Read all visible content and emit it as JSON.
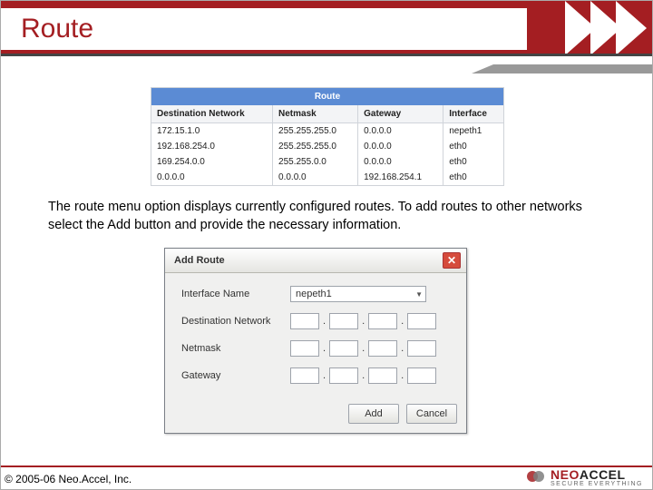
{
  "header": {
    "title": "Route"
  },
  "route_panel": {
    "title": "Route",
    "columns": [
      "Destination Network",
      "Netmask",
      "Gateway",
      "Interface"
    ],
    "rows": [
      {
        "dest": "172.15.1.0",
        "mask": "255.255.255.0",
        "gw": "0.0.0.0",
        "iface": "nepeth1"
      },
      {
        "dest": "192.168.254.0",
        "mask": "255.255.255.0",
        "gw": "0.0.0.0",
        "iface": "eth0"
      },
      {
        "dest": "169.254.0.0",
        "mask": "255.255.0.0",
        "gw": "0.0.0.0",
        "iface": "eth0"
      },
      {
        "dest": "0.0.0.0",
        "mask": "0.0.0.0",
        "gw": "192.168.254.1",
        "iface": "eth0"
      }
    ]
  },
  "description": "The route menu option displays currently configured routes. To add routes to other networks select the Add button and provide the necessary information.",
  "dialog": {
    "title": "Add Route",
    "fields": {
      "iface_label": "Interface Name",
      "iface_value": "nepeth1",
      "dest_label": "Destination Network",
      "mask_label": "Netmask",
      "gw_label": "Gateway"
    },
    "buttons": {
      "add": "Add",
      "cancel": "Cancel"
    }
  },
  "footer": {
    "copyright": "© 2005-06 Neo.Accel, Inc.",
    "brand_main_a": "NEO",
    "brand_main_b": "ACCEL",
    "brand_tag": "SECURE EVERYTHING"
  }
}
